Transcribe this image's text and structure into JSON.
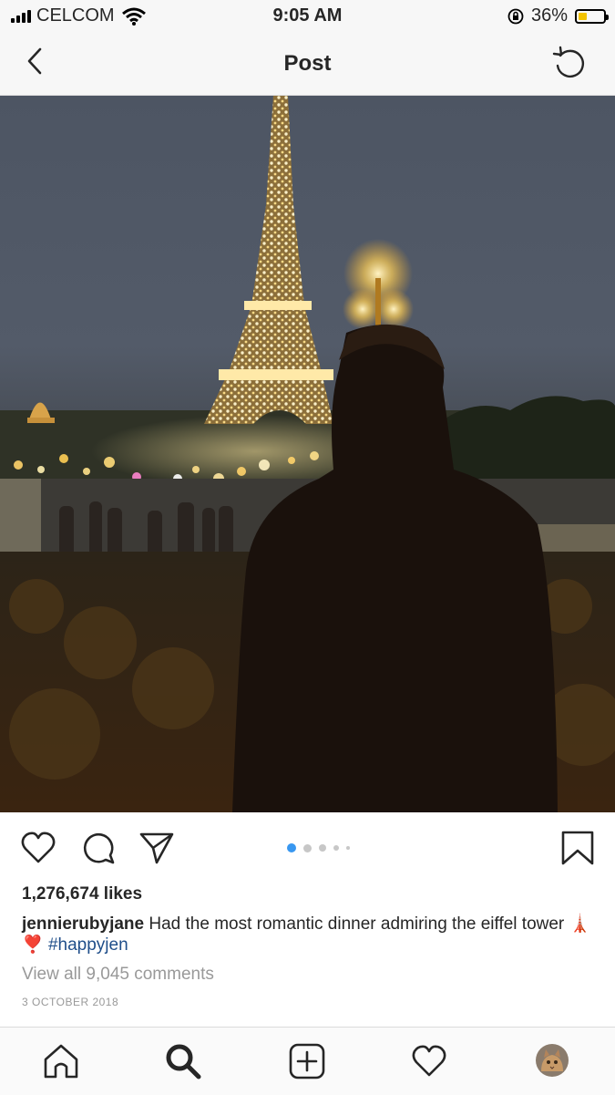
{
  "status_bar": {
    "carrier": "CELCOM",
    "time": "9:05 AM",
    "battery": "36%",
    "battery_level": 0.36,
    "battery_color": "#f2c300"
  },
  "header": {
    "title": "Post",
    "back_icon": "chevron-left-icon",
    "refresh_icon": "refresh-icon"
  },
  "post": {
    "image_description_icon": "photo",
    "carousel": {
      "count": 5,
      "active_index": 0,
      "active_color": "#3897f0"
    },
    "likes": "1,276,674 likes",
    "caption": {
      "username": "jennierubyjane",
      "text": "Had the most romantic dinner admiring the eiffel tower",
      "emojis": "🗼 ❣️",
      "hashtag": "#happyjen"
    },
    "view_comments": "View all 9,045 comments",
    "date": "3 OCTOBER 2018"
  },
  "actions": [
    "heart-icon",
    "comment-icon",
    "share-icon",
    "bookmark-icon"
  ],
  "tabbar": [
    "home-icon",
    "search-icon",
    "add-icon",
    "activity-heart-icon",
    "profile-avatar"
  ]
}
